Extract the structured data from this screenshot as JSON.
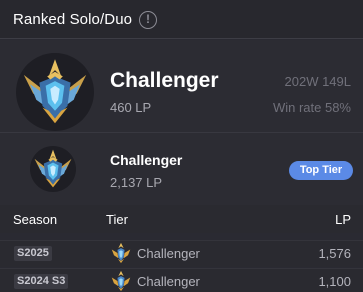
{
  "header": {
    "title": "Ranked Solo/Duo",
    "info_icon_glyph": "!"
  },
  "current": {
    "tier": "Challenger",
    "lp": "460 LP",
    "record": "202W 149L",
    "win_rate": "Win rate 58%",
    "emblem_icon": "challenger-emblem-icon"
  },
  "peak": {
    "tier": "Challenger",
    "lp": "2,137 LP",
    "badge": "Top Tier",
    "emblem_icon": "challenger-emblem-icon"
  },
  "table": {
    "columns": {
      "season": "Season",
      "tier": "Tier",
      "lp": "LP"
    },
    "rows": [
      {
        "season": "S2025",
        "tier": "Challenger",
        "lp": "1,576"
      },
      {
        "season": "S2024 S3",
        "tier": "Challenger",
        "lp": "1,100"
      }
    ]
  },
  "colors": {
    "background": "#2a2a32",
    "badge_blue": "#5b8ae6",
    "muted_text": "#70707a",
    "emblem_gold": "#d9a440",
    "emblem_blue": "#4fb6e8"
  }
}
